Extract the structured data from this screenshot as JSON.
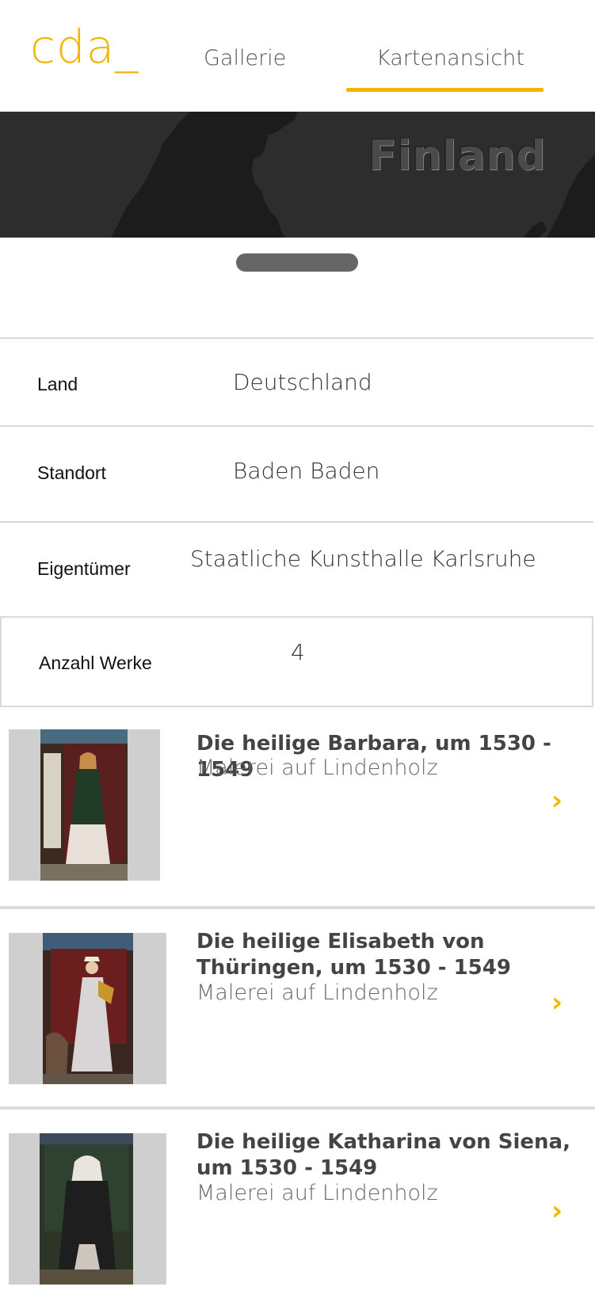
{
  "app": {
    "logo": "cda_",
    "tabs": [
      {
        "label": "Gallerie",
        "active": false
      },
      {
        "label": "Kartenansicht",
        "active": true
      }
    ],
    "accent_color": "#f5b400"
  },
  "map": {
    "label": "Finland"
  },
  "details": {
    "land_label": "Land",
    "land_value": "Deutschland",
    "standort_label": "Standort",
    "standort_value": "Baden Baden",
    "eigentuemer_label": "Eigentümer",
    "eigentuemer_value": "Staatliche Kunsthalle Karlsruhe",
    "anzahl_label": "Anzahl Werke",
    "anzahl_value": "4"
  },
  "works": [
    {
      "title": "Die heilige Barbara, um 1530 - 1549",
      "medium": "Malerei auf Lindenholz",
      "icon": "chevron-right-icon"
    },
    {
      "title": "Die heilige Elisabeth von Thüringen, um 1530 - 1549",
      "medium": "Malerei auf Lindenholz",
      "icon": "chevron-right-icon"
    },
    {
      "title": "Die heilige Katharina von Siena, um 1530 - 1549",
      "medium": "Malerei auf Lindenholz",
      "icon": "chevron-right-icon"
    }
  ]
}
